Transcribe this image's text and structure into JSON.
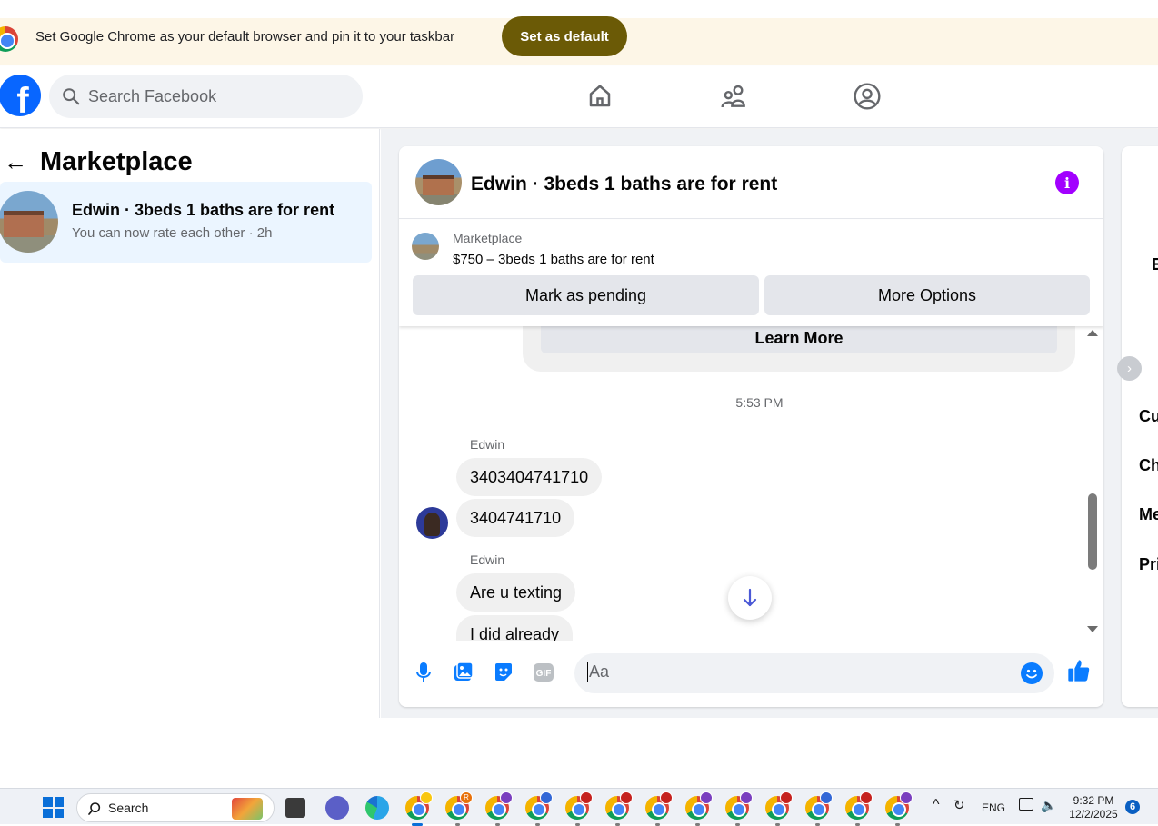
{
  "browser_banner": {
    "message": "Set Google Chrome as your default browser and pin it to your taskbar",
    "button_label": "Set as default"
  },
  "header": {
    "logo_letter": "f",
    "search_placeholder": "Search Facebook",
    "nav_icons": [
      "home-icon",
      "friends-icon",
      "profile-icon"
    ]
  },
  "sidebar": {
    "back_arrow": "←",
    "title": "Marketplace",
    "conversations": [
      {
        "title": "Edwin · 3beds 1 baths are for rent",
        "subtitle": "You can now rate each other · 2h"
      }
    ]
  },
  "chat": {
    "title": "Edwin · 3beds 1 baths are for rent",
    "info_glyph": "i",
    "listing": {
      "label": "Marketplace",
      "price_line": "$750 – 3beds 1 baths are for rent",
      "pending_button": "Mark as pending",
      "options_button": "More Options"
    },
    "learn_more_button": "Learn More",
    "timestamp": "5:53 PM",
    "messages": [
      {
        "sender": "Edwin",
        "text": "3403404741710"
      },
      {
        "sender": "",
        "text": "3404741710"
      },
      {
        "sender": "Edwin",
        "text": "Are u texting"
      },
      {
        "sender": "",
        "text": "I did already"
      }
    ],
    "scroll_down_glyph": "↓",
    "composer": {
      "placeholder": "Aa",
      "icons": [
        "microphone-icon",
        "photo-icon",
        "sticker-icon",
        "gif-icon",
        "emoji-icon",
        "like-icon"
      ],
      "gif_label": "GIF"
    }
  },
  "right_panel": {
    "items": [
      "E",
      "Cu",
      "Ch",
      "Me",
      "Pri"
    ],
    "collapse_glyph": "›"
  },
  "taskbar": {
    "search_label": "Search",
    "language": "ENG",
    "time": "9:32 PM",
    "date": "12/2/2025",
    "notification_count": "6",
    "chrome_badge_letter": "R"
  },
  "colors": {
    "facebook_blue": "#0866ff",
    "banner_button": "#6b5a06",
    "info_purple": "#a200ff",
    "scroll_arrow": "#4b59d6"
  }
}
